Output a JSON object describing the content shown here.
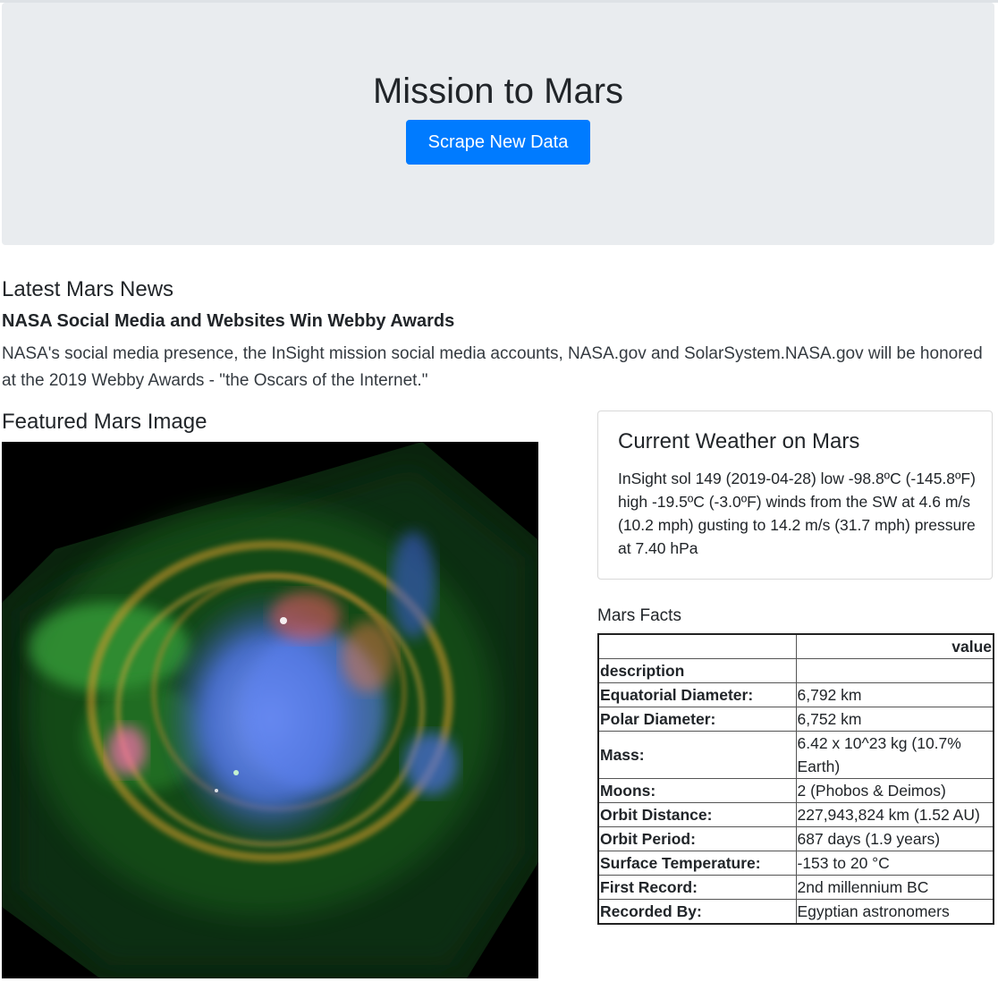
{
  "header": {
    "title": "Mission to Mars",
    "scrape_button": "Scrape New Data"
  },
  "news": {
    "section_heading": "Latest Mars News",
    "title": "NASA Social Media and Websites Win Webby Awards",
    "paragraph": "NASA's social media presence, the InSight mission social media accounts, NASA.gov and SolarSystem.NASA.gov will be honored at the 2019 Webby Awards - \"the Oscars of the Internet.\""
  },
  "featured": {
    "section_heading": "Featured Mars Image"
  },
  "weather": {
    "title": "Current Weather on Mars",
    "text": "InSight sol 149 (2019-04-28) low -98.8ºC (-145.8ºF) high -19.5ºC (-3.0ºF) winds from the SW at 4.6 m/s (10.2 mph) gusting to 14.2 m/s (31.7 mph) pressure at 7.40 hPa"
  },
  "facts": {
    "caption": "Mars Facts",
    "column_header": "value",
    "index_header": "description",
    "rows": [
      {
        "label": "Equatorial Diameter:",
        "value": "6,792 km"
      },
      {
        "label": "Polar Diameter:",
        "value": "6,752 km"
      },
      {
        "label": "Mass:",
        "value": "6.42 x 10^23 kg (10.7% Earth)"
      },
      {
        "label": "Moons:",
        "value": "2 (Phobos & Deimos)"
      },
      {
        "label": "Orbit Distance:",
        "value": "227,943,824 km (1.52 AU)"
      },
      {
        "label": "Orbit Period:",
        "value": "687 days (1.9 years)"
      },
      {
        "label": "Surface Temperature:",
        "value": "-153 to 20 °C"
      },
      {
        "label": "First Record:",
        "value": "2nd millennium BC"
      },
      {
        "label": "Recorded By:",
        "value": "Egyptian astronomers"
      }
    ]
  },
  "colors": {
    "jumbotron_bg": "#e9ecef",
    "button_primary": "#007bff"
  }
}
